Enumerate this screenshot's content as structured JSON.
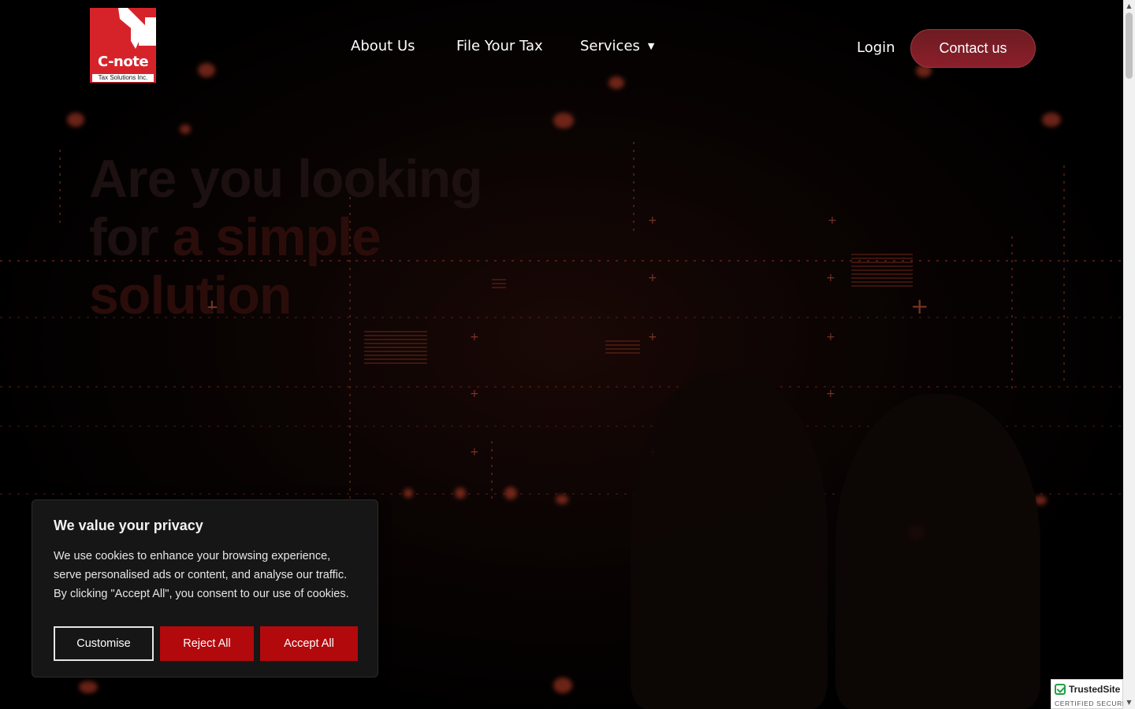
{
  "header": {
    "logo": {
      "name": "C-note",
      "subtitle": "Tax Solutions Inc.",
      "brand_color": "#d6232a"
    },
    "nav": [
      {
        "label": "About Us"
      },
      {
        "label": "File Your Tax"
      },
      {
        "label": "Services",
        "icon": "chevron-down-icon"
      }
    ],
    "login_label": "Login",
    "contact_label": "Contact us"
  },
  "hero": {
    "title_line1": "Are you looking",
    "title_line2_prefix": "for",
    "title_line2_accent": "a simple solution"
  },
  "cookie_banner": {
    "title": "We value your privacy",
    "text": "We use cookies to enhance your browsing experience, serve personalised ads or content, and analyse our traffic. By clicking \"Accept All\", you consent to our use of cookies.",
    "customise_label": "Customise",
    "reject_label": "Reject All",
    "accept_label": "Accept All",
    "accent_color": "#b2090d"
  },
  "badge": {
    "name": "TrustedSite",
    "subtitle": "CERTIFIED SECURE"
  }
}
